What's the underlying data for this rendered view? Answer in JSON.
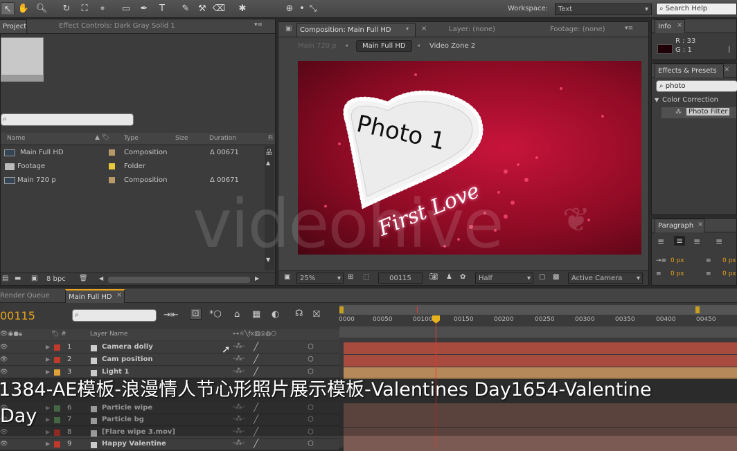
{
  "toolbar": {
    "workspace_label": "Workspace:",
    "workspace_value": "Text",
    "search_help_placeholder": "Search Help"
  },
  "project_panel": {
    "tabs": [
      "Project",
      "Effect Controls: Dark Gray Solid 1"
    ],
    "columns": [
      "Name",
      "Type",
      "Size",
      "Duration",
      "Fi"
    ],
    "items": [
      {
        "name": "Main Full HD",
        "type": "Composition",
        "duration": "Δ 00671",
        "color": "#b89a6a"
      },
      {
        "name": "Footage",
        "type": "Folder",
        "duration": "",
        "color": "#e7c93a"
      },
      {
        "name": "Main 720 p",
        "type": "Composition",
        "duration": "Δ 00671",
        "color": "#b89a6a"
      }
    ],
    "bpc": "8 bpc"
  },
  "composition_panel": {
    "tabs": [
      "Composition: Main Full HD",
      "Layer: (none)",
      "Footage: (none)"
    ],
    "breadcrumbs": [
      "Main 720 p",
      "Main Full HD",
      "Video Zone 2"
    ],
    "zoom": "25%",
    "timecode": "00115",
    "resolution": "Half",
    "camera": "Active Camera",
    "preview_photo_text": "Photo 1",
    "preview_script_text": "First Love"
  },
  "info_panel": {
    "tab": "Info",
    "r_label": "R : 33",
    "g_label": "G : 1"
  },
  "effects_panel": {
    "tab": "Effects & Presets",
    "search_value": "photo",
    "category": "Color Correction",
    "effect": "Photo Filter"
  },
  "paragraph_panel": {
    "tab": "Paragraph",
    "indent_left": "0 px",
    "indent_right": "0 px",
    "space_before": "0 px",
    "space_after": "0 px"
  },
  "timeline": {
    "tabs": [
      "Render Queue",
      "Main Full HD"
    ],
    "timecode": "00115",
    "column_header": "Layer Name",
    "ruler": [
      "0000",
      "00050",
      "00100",
      "00150",
      "00200",
      "00250",
      "00300",
      "00350",
      "00400",
      "00450"
    ],
    "layers": [
      {
        "num": "1",
        "name": "Camera dolly",
        "color": "#c0392b"
      },
      {
        "num": "2",
        "name": "Cam position",
        "color": "#c0392b"
      },
      {
        "num": "3",
        "name": "Light 1",
        "color": "#e0a13a"
      },
      {
        "num": "6",
        "name": "Particle wipe",
        "color": "#5a8a5a"
      },
      {
        "num": "7",
        "name": "Particle bg",
        "color": "#5a8a5a"
      },
      {
        "num": "8",
        "name": "[Flare wipe 3.mov]",
        "color": "#c0392b"
      },
      {
        "num": "9",
        "name": "Happy Valentine",
        "color": "#c0392b"
      }
    ]
  },
  "overlay": {
    "watermark": "videohive",
    "caption_line1": "1384-AE模板-浪漫情人节心形照片展示模板-Valentines Day1654-Valentine",
    "caption_line2": "Day"
  },
  "colors": {
    "accent_orange": "#e8a21c",
    "layer_red": "#a64b3e",
    "comp_bg": "#a0102a"
  }
}
